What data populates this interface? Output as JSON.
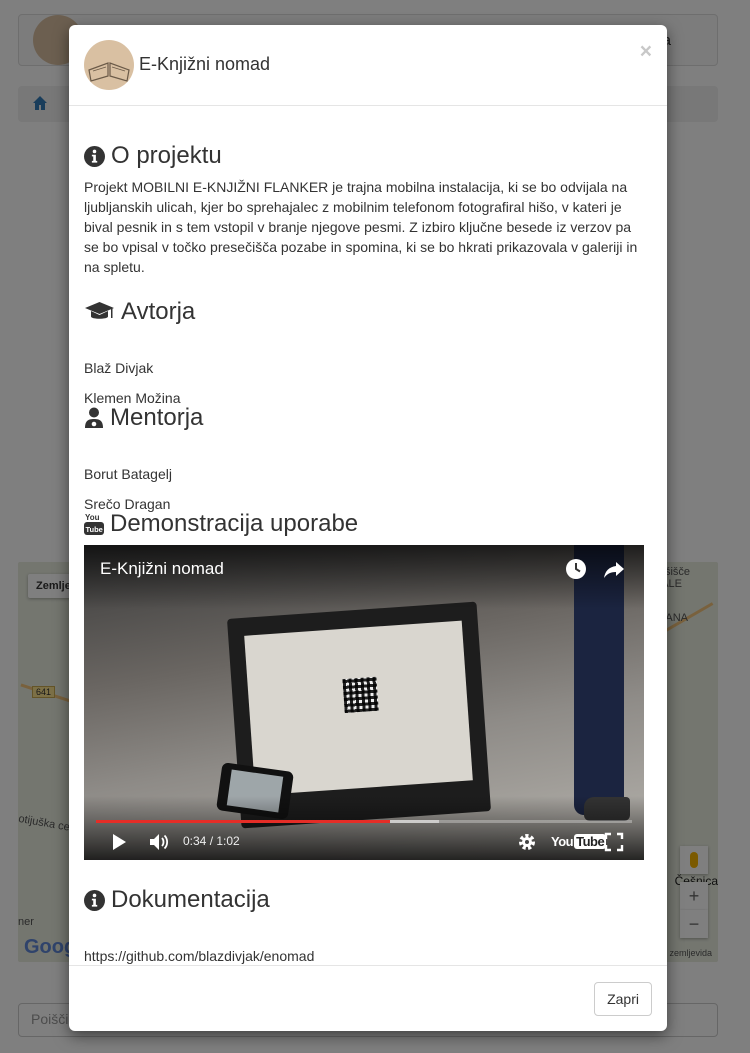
{
  "background": {
    "nav_tail": "a",
    "map_type": "Zemlje",
    "map_labels": [
      "šišče",
      "ALE",
      "ANA",
      "Češnica"
    ],
    "road_number": "641",
    "street_label": "otijuška cest",
    "map_corner_text": "ner",
    "google_text": "Goog",
    "map_footer": "zemljevida",
    "zoom_in": "+",
    "zoom_out": "−",
    "search_placeholder": "Poišči"
  },
  "modal": {
    "title": "E-Knjižni nomad",
    "close_symbol": "×",
    "sections": {
      "about": {
        "heading": "O projektu",
        "text": "Projekt MOBILNI E-KNJIŽNI FLANKER je trajna mobilna instalacija, ki se bo odvijala na ljubljanskih ulicah, kjer bo sprehajalec z mobilnim telefonom fotografiral hišo, v kateri je bival pesnik in s tem vstopil v branje njegove pesmi. Z izbiro ključne besede iz verzov pa se bo vpisal v točko presečišča pozabe in spomina, ki se bo hkrati prikazovala v galeriji in na spletu."
      },
      "authors": {
        "heading": "Avtorja",
        "names": [
          "Blaž Divjak",
          "Klemen Možina"
        ]
      },
      "mentors": {
        "heading": "Mentorja",
        "names": [
          "Borut Batagelj",
          "Srečo Dragan"
        ]
      },
      "demo": {
        "heading": "Demonstracija uporabe",
        "video": {
          "title": "E-Knjižni nomad",
          "time": "0:34 / 1:02",
          "played_fraction": 0.548,
          "buffered_fraction": 0.64,
          "brand": "You",
          "brand_tube": "Tube"
        }
      },
      "docs": {
        "heading": "Dokumentacija",
        "link": "https://github.com/blazdivjak/enomad"
      }
    },
    "footer_button": "Zapri"
  },
  "colors": {
    "progress": "#e52d27",
    "backdrop": "rgba(0,0,0,0.5)",
    "text": "#333333"
  }
}
